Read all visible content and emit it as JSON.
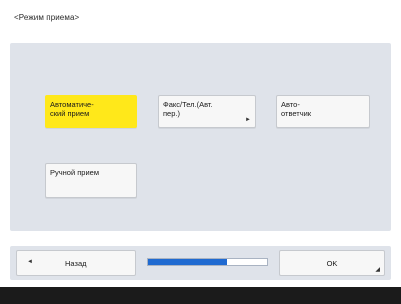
{
  "screen": {
    "title": "<Режим приема>"
  },
  "options": [
    {
      "label": "Автоматиче-\nский прием",
      "selected": true
    },
    {
      "label": "Факс/Тел.(Авт.\nпер.)",
      "selected": false,
      "more_icon": "right-arrow-icon"
    },
    {
      "label": "Авто-\nответчик",
      "selected": false
    },
    {
      "label": "Ручной прием",
      "selected": false
    }
  ],
  "footer": {
    "back_label": "Назад",
    "back_icon": "left-triangle-icon",
    "ok_label": "OK",
    "ok_icon": "corner-arrow-icon",
    "progress_fraction": 0.66
  },
  "colors": {
    "selected": "#ffe81a",
    "panel": "#dfe3ea",
    "progress": "#1f6ad1",
    "bottom_strip": "#1b1b1b"
  }
}
